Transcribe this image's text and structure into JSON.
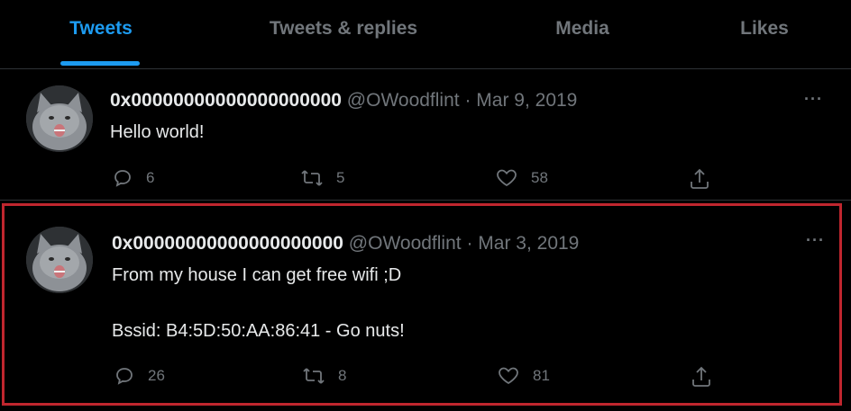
{
  "tabs": [
    {
      "label": "Tweets",
      "active": true
    },
    {
      "label": "Tweets & replies",
      "active": false
    },
    {
      "label": "Media",
      "active": false
    },
    {
      "label": "Likes",
      "active": false
    }
  ],
  "tweets": [
    {
      "display_name": "0x00000000000000000000",
      "handle": "@OWoodflint",
      "separator": "·",
      "date": "Mar 9, 2019",
      "text_lines": [
        "Hello world!"
      ],
      "replies": "6",
      "retweets": "5",
      "likes": "58",
      "highlighted": false
    },
    {
      "display_name": "0x00000000000000000000",
      "handle": "@OWoodflint",
      "separator": "·",
      "date": "Mar 3, 2019",
      "text_lines": [
        "From my house I can get free wifi ;D",
        "Bssid: B4:5D:50:AA:86:41 - Go nuts!"
      ],
      "replies": "26",
      "retweets": "8",
      "likes": "81",
      "highlighted": true
    }
  ],
  "more_icon_glyph": "···",
  "colors": {
    "accent": "#1d9bf0",
    "highlight_border": "#c0262e",
    "background": "#000000"
  },
  "icons": [
    "reply-icon",
    "retweet-icon",
    "like-icon",
    "share-icon",
    "more-icon"
  ]
}
